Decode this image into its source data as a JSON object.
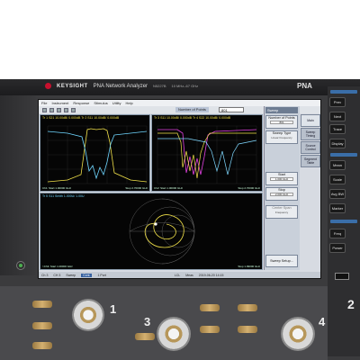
{
  "instrument": {
    "brand": "KEYSIGHT",
    "product": "PNA Network Analyzer",
    "model": "N5227B",
    "range": "10 MHz–67 GHz",
    "badge": "PNA"
  },
  "menu": [
    "File",
    "Instrument",
    "Response",
    "Stimulus",
    "Utility",
    "Help"
  ],
  "toolbar": {
    "points_label": "Number of Points",
    "points_value": "801"
  },
  "plots": {
    "top_left": {
      "header1": "Tr 1  S21 10.00dB/ 0.000dB   Tr 2  S11 10.00dB/ 0.000dB",
      "footer_left": "Ch1: Start 1.00000 GHz",
      "footer_right": "Stop 2.70000 GHz"
    },
    "top_right": {
      "header1": "Tr 3  S11 10.00dB/ 0.000dB   Tr 4  S22 10.00dB/ 0.000dB",
      "footer_left": "Ch2: Start 1.00000 GHz",
      "footer_right": "Stop 2.70000 GHz"
    },
    "bottom": {
      "header1": "Tr 5  S11 Smith 1.000U/ 1.00U",
      "footer_left": ">Ch3: Start 1.00000 GHz",
      "footer_right": "Stop 1.99000 GHz"
    }
  },
  "softkeys": {
    "title": "Sweep",
    "keys": [
      {
        "label": "Number of Points",
        "value": "801"
      },
      {
        "label": "Sweep Type",
        "sub": "Linear Frequency"
      },
      {
        "label": "Start",
        "value": "1.000 GHz"
      },
      {
        "label": "Stop",
        "value": "2.000 GHz"
      },
      {
        "label": "Center Span",
        "sub": "Frequency",
        "dim": true
      },
      {
        "label": "Sweep Setup..."
      }
    ],
    "tabs": [
      "Main",
      "Sweep Timing",
      "Source Control",
      "Segment Table"
    ]
  },
  "statusbar": [
    "Ch 3",
    "CH 3",
    "Sweep",
    "Cont.",
    "1 Port",
    "LCL",
    "Meas",
    "2019-06-20 14:15"
  ],
  "hardkeys": {
    "instrument_row": [
      "Prev",
      "Next"
    ],
    "rows": [
      "Trace",
      "Channel",
      "Display",
      "Mean",
      "Scale",
      "Avg BW",
      "Marker",
      "Search",
      "Freq",
      "Power",
      "Sweep",
      "Trigger"
    ]
  },
  "ports": [
    "1",
    "3",
    "4",
    "2"
  ]
}
